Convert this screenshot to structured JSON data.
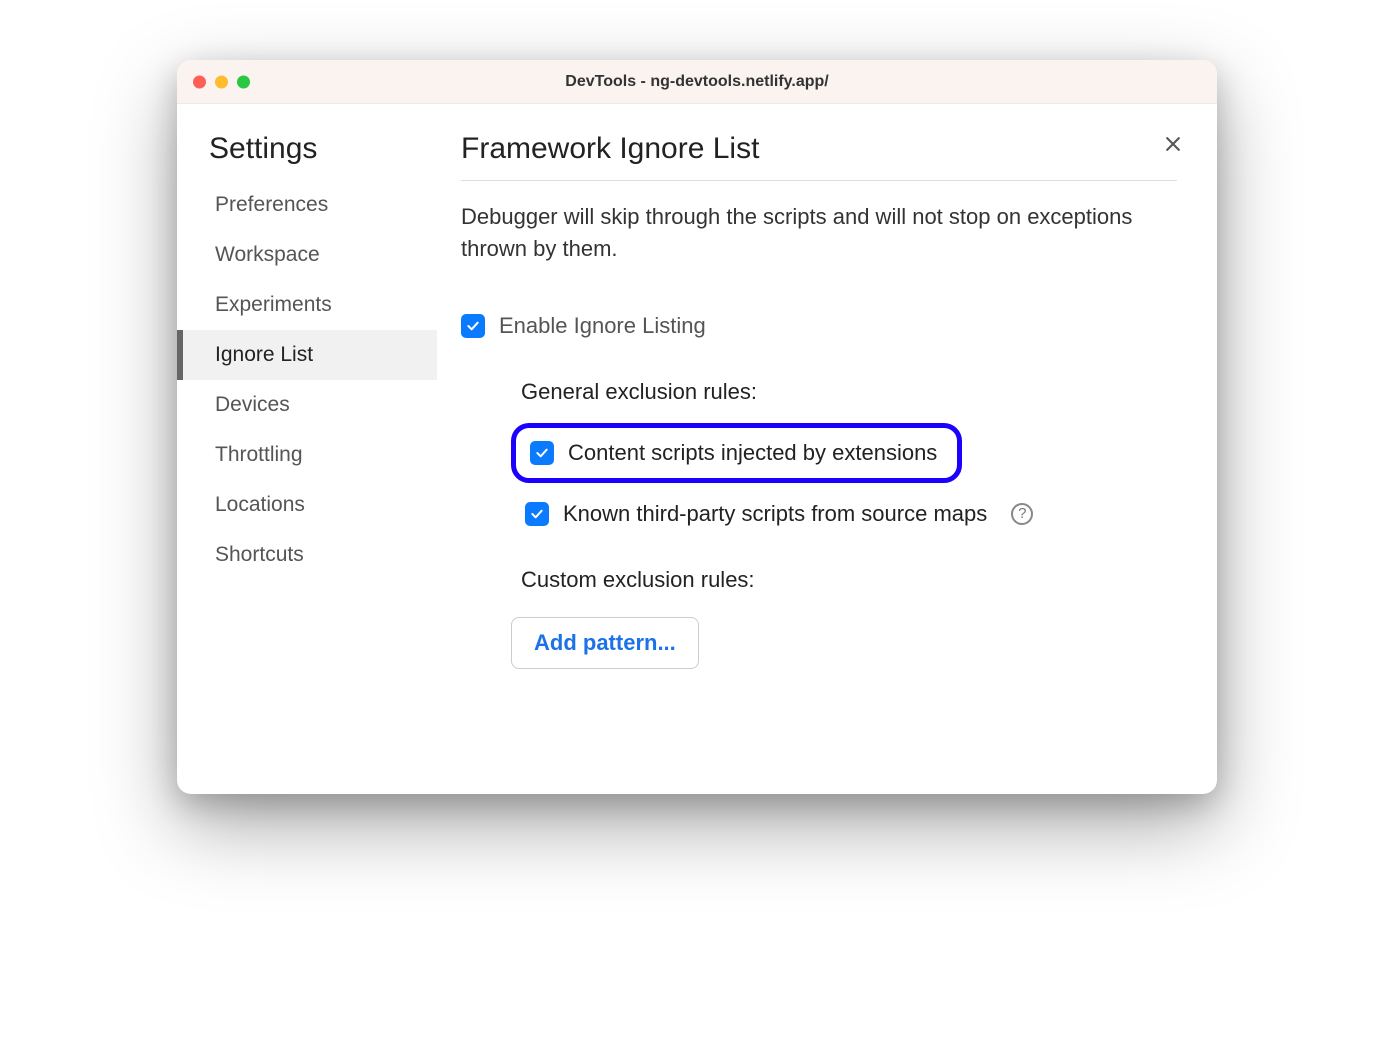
{
  "window": {
    "title": "DevTools - ng-devtools.netlify.app/"
  },
  "sidebar": {
    "title": "Settings",
    "items": [
      {
        "label": "Preferences",
        "active": false
      },
      {
        "label": "Workspace",
        "active": false
      },
      {
        "label": "Experiments",
        "active": false
      },
      {
        "label": "Ignore List",
        "active": true
      },
      {
        "label": "Devices",
        "active": false
      },
      {
        "label": "Throttling",
        "active": false
      },
      {
        "label": "Locations",
        "active": false
      },
      {
        "label": "Shortcuts",
        "active": false
      }
    ]
  },
  "content": {
    "title": "Framework Ignore List",
    "description": "Debugger will skip through the scripts and will not stop on exceptions thrown by them.",
    "enable_label": "Enable Ignore Listing",
    "general_rules_heading": "General exclusion rules:",
    "rule_content_scripts": "Content scripts injected by extensions",
    "rule_third_party": "Known third-party scripts from source maps",
    "custom_rules_heading": "Custom exclusion rules:",
    "add_pattern_label": "Add pattern...",
    "help_glyph": "?"
  },
  "colors": {
    "accent": "#0a7aff",
    "highlight_border": "#1b00ff",
    "link": "#1d72e8"
  }
}
